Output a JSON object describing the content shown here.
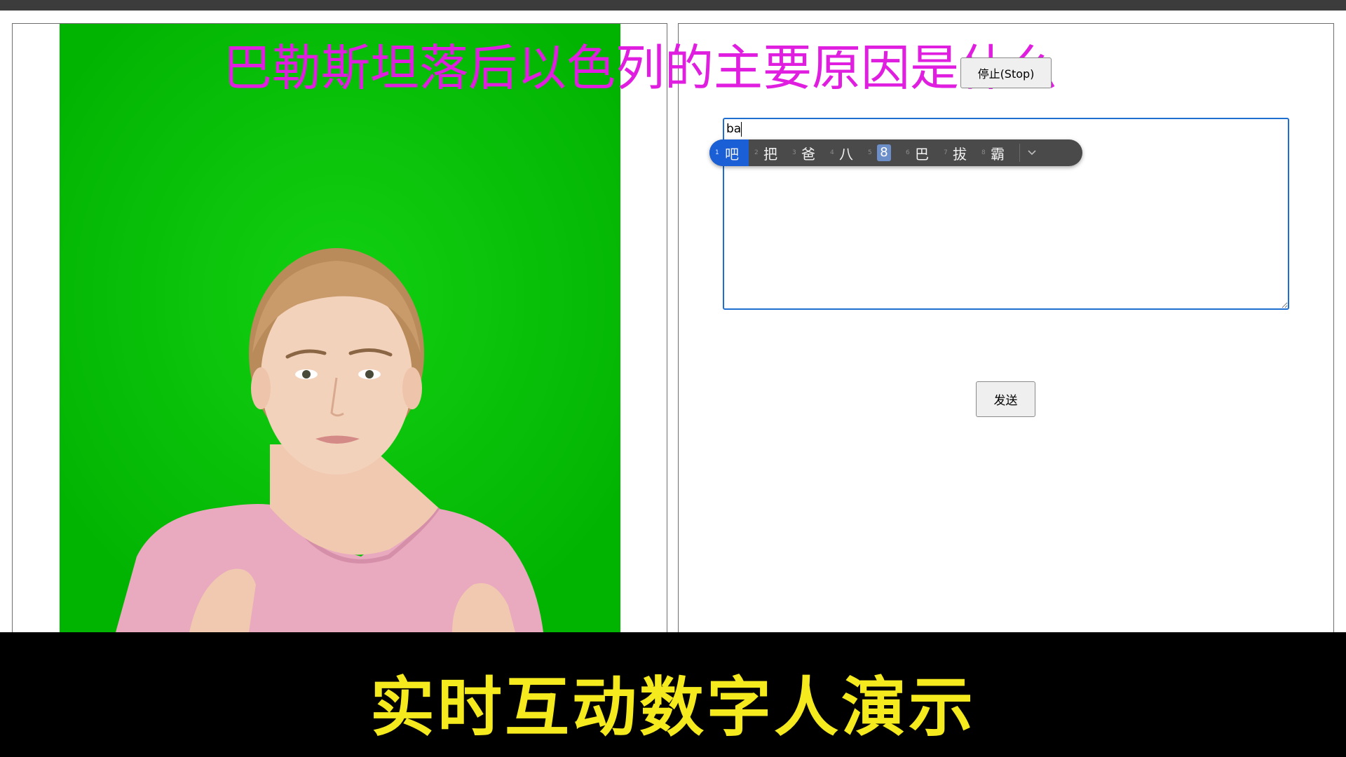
{
  "overlay": {
    "question": "巴勒斯坦落后以色列的主要原因是什么",
    "caption": "实时互动数字人演示"
  },
  "controls": {
    "stop_label": "停止(Stop)",
    "send_label": "发送",
    "input_value": "ba"
  },
  "ime": {
    "candidates": [
      {
        "num": "1",
        "char": "吧"
      },
      {
        "num": "2",
        "char": "把"
      },
      {
        "num": "3",
        "char": "爸"
      },
      {
        "num": "4",
        "char": "八"
      },
      {
        "num": "5",
        "char": "8"
      },
      {
        "num": "6",
        "char": "巴"
      },
      {
        "num": "7",
        "char": "拔"
      },
      {
        "num": "8",
        "char": "霸"
      }
    ],
    "selected_index": 0,
    "expand_icon": "chevron-down-icon"
  },
  "colors": {
    "green_screen": "#03c003",
    "question_text": "#e01ee0",
    "caption_text": "#f4ea1e",
    "ime_selected": "#1a5fd6",
    "input_focus": "#1f6fd1"
  }
}
